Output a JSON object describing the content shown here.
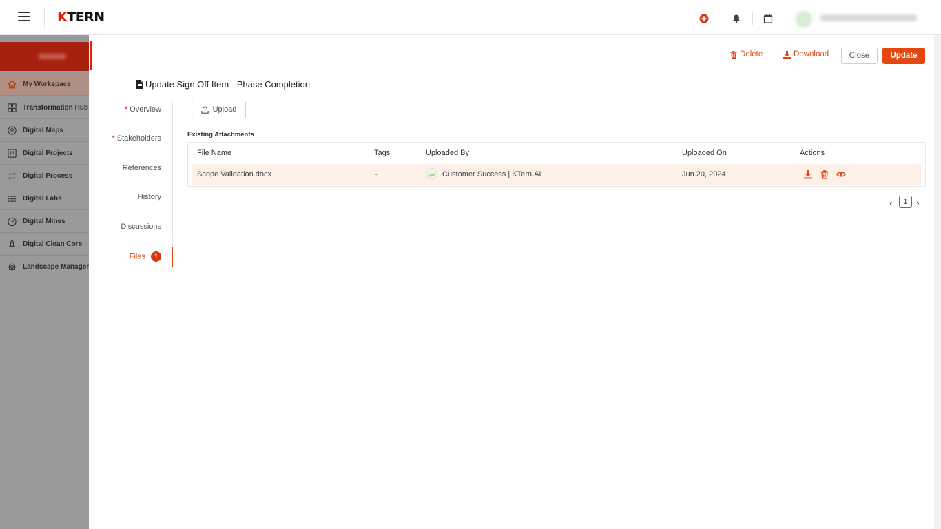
{
  "app": {
    "logo_text": "TERN",
    "logo_k": "K"
  },
  "sidebar": {
    "items": [
      {
        "label": "My Workspace",
        "icon": "home-icon",
        "active": true
      },
      {
        "label": "Transformation Hub",
        "icon": "grid-icon"
      },
      {
        "label": "Digital Maps",
        "icon": "map-pin-icon"
      },
      {
        "label": "Digital Projects",
        "icon": "kanban-icon"
      },
      {
        "label": "Digital Process",
        "icon": "flow-arrows-icon"
      },
      {
        "label": "Digital Labs",
        "icon": "list-icon"
      },
      {
        "label": "Digital Mines",
        "icon": "gauge-icon"
      },
      {
        "label": "Digital Clean Core",
        "icon": "rocket-icon"
      },
      {
        "label": "Landscape Managen",
        "icon": "gear-icon"
      }
    ]
  },
  "toolbar": {
    "delete_label": "Delete",
    "download_label": "Download",
    "close_label": "Close",
    "update_label": "Update"
  },
  "page": {
    "title": "Update Sign Off Item - Phase Completion"
  },
  "tabs": {
    "required_mark": "*",
    "overview": "Overview",
    "stakeholders": "Stakeholders",
    "references": "References",
    "history": "History",
    "discussions": "Discussions",
    "files": "Files",
    "files_count": "1"
  },
  "files": {
    "upload_label": "Upload",
    "existing_label": "Existing Attachments",
    "columns": {
      "file_name": "File Name",
      "tags": "Tags",
      "uploaded_by": "Uploaded By",
      "uploaded_on": "Uploaded On",
      "actions": "Actions"
    },
    "rows": [
      {
        "file_name": "Scope Validation.docx",
        "tags": "-",
        "uploaded_by": "Customer Success | KTern.AI",
        "uploaded_on": "Jun 20, 2024"
      }
    ]
  },
  "pagination": {
    "current_page": "1",
    "prev": "‹",
    "next": "›"
  },
  "colors": {
    "brand": "#d9230f",
    "accent": "#e5470f",
    "row_highlight": "#fdf0e8"
  }
}
